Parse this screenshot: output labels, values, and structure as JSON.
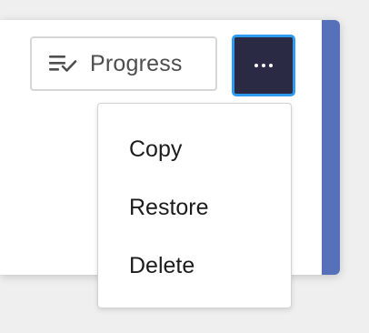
{
  "toolbar": {
    "progress_label": "Progress",
    "progress_icon": "list-check-icon",
    "more_icon": "more-horizontal-icon"
  },
  "menu": {
    "items": [
      {
        "label": "Copy"
      },
      {
        "label": "Restore"
      },
      {
        "label": "Delete"
      }
    ]
  },
  "colors": {
    "accent": "#5670b9",
    "more_button_bg": "#2a2a45",
    "focus_ring": "#2f9bf0"
  }
}
